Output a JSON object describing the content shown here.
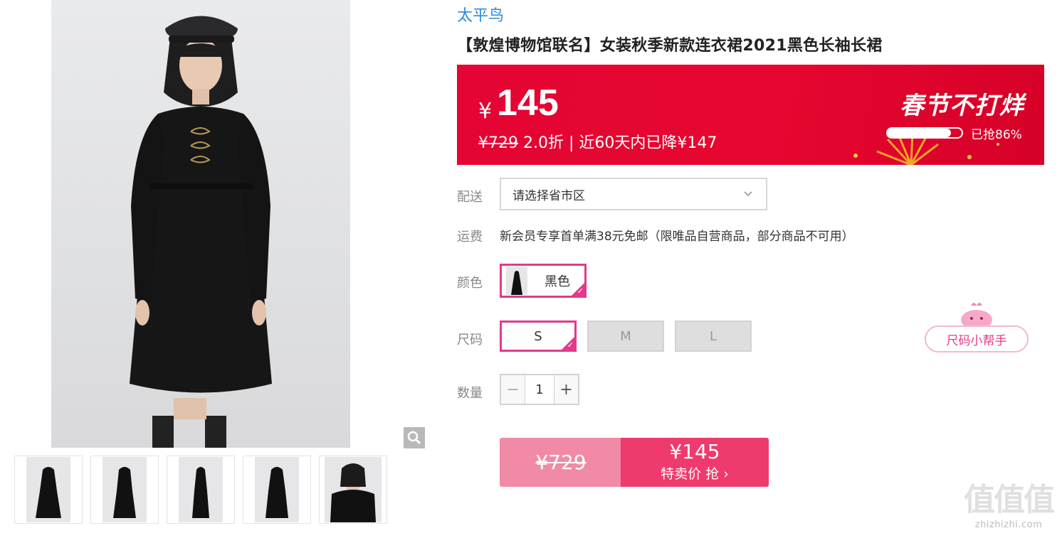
{
  "brand": "太平鸟",
  "title": "【敦煌博物馆联名】女装秋季新款连衣裙2021黑色长袖长裙",
  "price_banner": {
    "currency": "¥",
    "current_price": "145",
    "original_price": "¥729",
    "discount": "2.0折 | 近60天内已降¥147",
    "promo_text": "春节不打烊",
    "grabbed_text": "已抢86%",
    "grabbed_percent": 86,
    "banner_color": "#e40534"
  },
  "delivery": {
    "label": "配送",
    "placeholder": "请选择省市区"
  },
  "shipping": {
    "label": "运费",
    "text": "新会员专享首单满38元免邮（限唯品自营商品，部分商品不可用）"
  },
  "color": {
    "label": "颜色",
    "options": [
      {
        "name": "黑色",
        "selected": true
      }
    ]
  },
  "size": {
    "label": "尺码",
    "options": [
      {
        "name": "S",
        "selected": true,
        "available": true
      },
      {
        "name": "M",
        "selected": false,
        "available": false
      },
      {
        "name": "L",
        "selected": false,
        "available": false
      }
    ],
    "helper_label": "尺码小帮手"
  },
  "quantity": {
    "label": "数量",
    "value": "1",
    "minus": "−",
    "plus": "+"
  },
  "buy": {
    "original_price": "¥729",
    "special_price": "¥145",
    "action_text": "特卖价 抢 ›",
    "accent_color": "#ef3a6d"
  },
  "gallery": {
    "thumbnail_count": 5,
    "zoom_icon": "magnifier-icon"
  },
  "watermark": {
    "big": "值值值",
    "small": "zhizhizhi.com"
  }
}
